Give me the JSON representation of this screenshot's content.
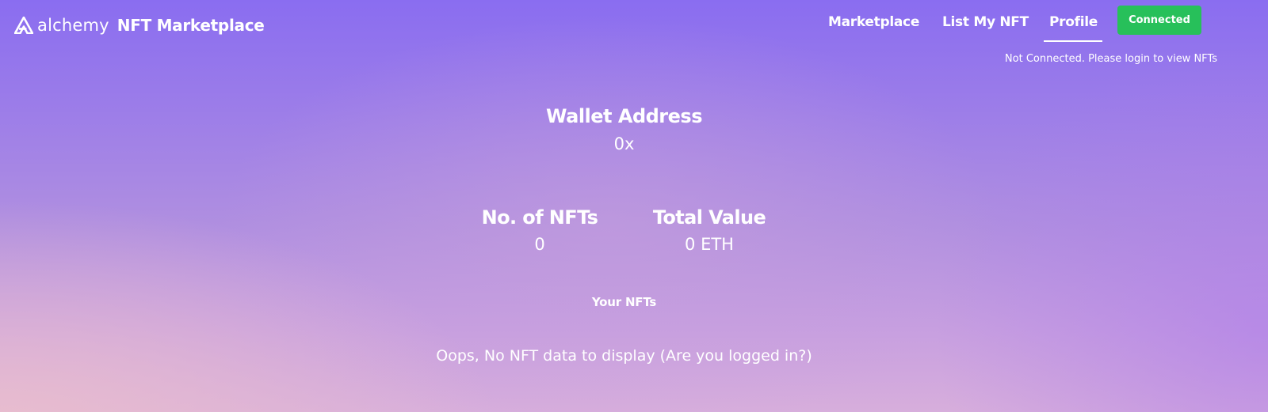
{
  "brand": {
    "logo_icon": "alchemy-logo-icon",
    "name": "alchemy",
    "title": "NFT Marketplace"
  },
  "nav": {
    "items": [
      {
        "label": "Marketplace",
        "active": false
      },
      {
        "label": "List My NFT",
        "active": false
      },
      {
        "label": "Profile",
        "active": true
      }
    ],
    "connect_button_label": "Connected",
    "connect_button_color": "#27c05a",
    "connection_status": "Not Connected. Please login to view NFTs"
  },
  "profile": {
    "wallet_heading": "Wallet Address",
    "wallet_value": "0x",
    "stats": [
      {
        "heading": "No. of NFTs",
        "value": "0"
      },
      {
        "heading": "Total Value",
        "value": "0 ETH"
      }
    ],
    "your_nfts_heading": "Your NFTs",
    "empty_message": "Oops, No NFT data to display (Are you logged in?)"
  },
  "colors": {
    "background_top": "#8a6df0",
    "background_bottom": "#d7aedc",
    "text": "#ffffff"
  }
}
